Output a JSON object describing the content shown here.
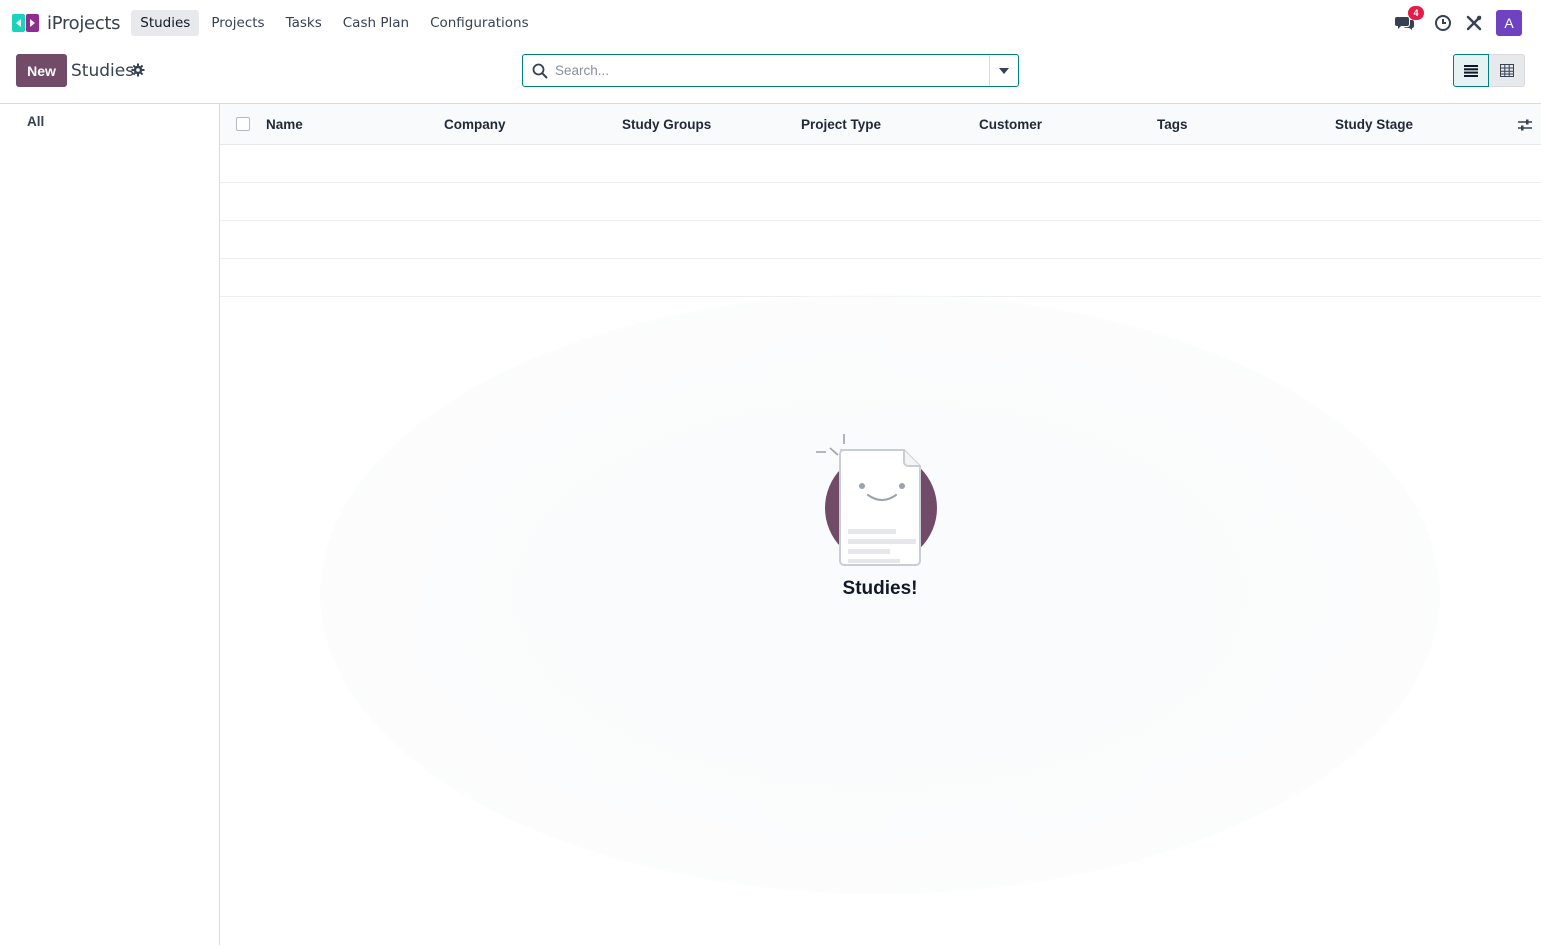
{
  "app": {
    "name": "iProjects",
    "brand_colors": {
      "left": "#1ad3bb",
      "right": "#8f2d8f"
    }
  },
  "menu": [
    {
      "label": "Studies",
      "active": true
    },
    {
      "label": "Projects",
      "active": false
    },
    {
      "label": "Tasks",
      "active": false
    },
    {
      "label": "Cash Plan",
      "active": false
    },
    {
      "label": "Configurations",
      "active": false
    }
  ],
  "systray": {
    "messages_icon": "chat-bubbles-icon",
    "messages_count": "4",
    "activity_icon": "clock-icon",
    "debug_icon": "tools-icon",
    "avatar_initial": "A",
    "avatar_color": "#6f42c1"
  },
  "control_panel": {
    "new_label": "New",
    "title": "Studies",
    "settings_icon": "gear-icon",
    "search_placeholder": "Search...",
    "accent_color": "#714b67"
  },
  "views": [
    {
      "name": "list",
      "icon": "list-view-icon",
      "active": true
    },
    {
      "name": "grid",
      "icon": "table-grid-icon",
      "active": false
    }
  ],
  "sidebar": {
    "items": [
      {
        "label": "All"
      }
    ]
  },
  "table": {
    "columns": [
      "Name",
      "Company",
      "Study Groups",
      "Project Type",
      "Customer",
      "Tags",
      "Study Stage"
    ],
    "rows": []
  },
  "empty_state": {
    "title": "Studies!"
  }
}
